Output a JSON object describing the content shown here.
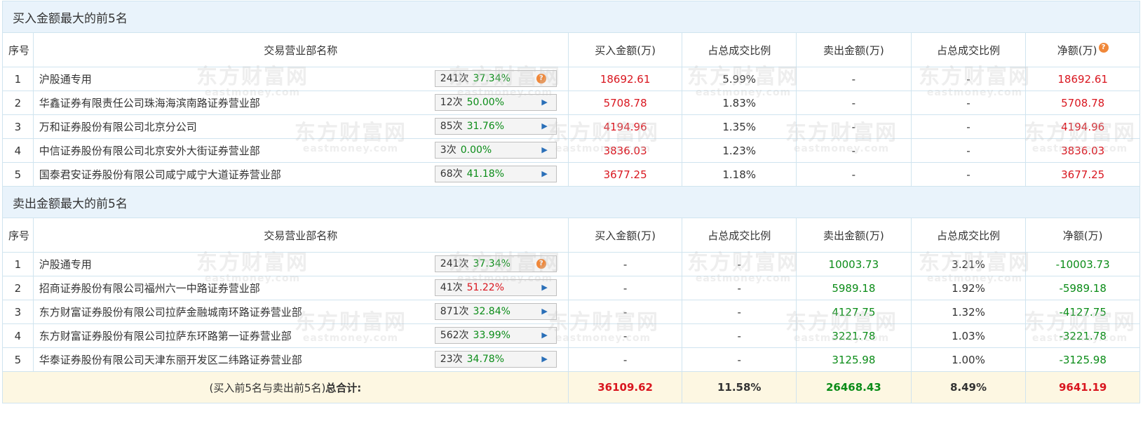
{
  "buy_section": {
    "title": "买入金额最大的前5名",
    "headers": {
      "idx": "序号",
      "name": "交易营业部名称",
      "buy": "买入金额(万)",
      "buy_ratio": "占总成交比例",
      "sell": "卖出金额(万)",
      "sell_ratio": "占总成交比例",
      "net": "净额(万)"
    },
    "rows": [
      {
        "idx": "1",
        "name": "沪股通专用",
        "count": "241次",
        "pct": "37.34%",
        "buy": "18692.61",
        "buy_ratio": "5.99%",
        "sell": "-",
        "sell_ratio": "-",
        "net": "18692.61"
      },
      {
        "idx": "2",
        "name": "华鑫证券有限责任公司珠海海滨南路证券营业部",
        "count": "12次",
        "pct": "50.00%",
        "buy": "5708.78",
        "buy_ratio": "1.83%",
        "sell": "-",
        "sell_ratio": "-",
        "net": "5708.78"
      },
      {
        "idx": "3",
        "name": "万和证券股份有限公司北京分公司",
        "count": "85次",
        "pct": "31.76%",
        "buy": "4194.96",
        "buy_ratio": "1.35%",
        "sell": "-",
        "sell_ratio": "-",
        "net": "4194.96"
      },
      {
        "idx": "4",
        "name": "中信证券股份有限公司北京安外大街证券营业部",
        "count": "3次",
        "pct": "0.00%",
        "buy": "3836.03",
        "buy_ratio": "1.23%",
        "sell": "-",
        "sell_ratio": "-",
        "net": "3836.03"
      },
      {
        "idx": "5",
        "name": "国泰君安证券股份有限公司咸宁咸宁大道证券营业部",
        "count": "68次",
        "pct": "41.18%",
        "buy": "3677.25",
        "buy_ratio": "1.18%",
        "sell": "-",
        "sell_ratio": "-",
        "net": "3677.25"
      }
    ]
  },
  "sell_section": {
    "title": "卖出金额最大的前5名",
    "headers": {
      "idx": "序号",
      "name": "交易营业部名称",
      "buy": "买入金额(万)",
      "buy_ratio": "占总成交比例",
      "sell": "卖出金额(万)",
      "sell_ratio": "占总成交比例",
      "net": "净额(万)"
    },
    "rows": [
      {
        "idx": "1",
        "name": "沪股通专用",
        "count": "241次",
        "pct": "37.34%",
        "buy": "-",
        "buy_ratio": "-",
        "sell": "10003.73",
        "sell_ratio": "3.21%",
        "net": "-10003.73"
      },
      {
        "idx": "2",
        "name": "招商证券股份有限公司福州六一中路证券营业部",
        "count": "41次",
        "pct": "51.22%",
        "buy": "-",
        "buy_ratio": "-",
        "sell": "5989.18",
        "sell_ratio": "1.92%",
        "net": "-5989.18"
      },
      {
        "idx": "3",
        "name": "东方财富证券股份有限公司拉萨金融城南环路证券营业部",
        "count": "871次",
        "pct": "32.84%",
        "buy": "-",
        "buy_ratio": "-",
        "sell": "4127.75",
        "sell_ratio": "1.32%",
        "net": "-4127.75"
      },
      {
        "idx": "4",
        "name": "东方财富证券股份有限公司拉萨东环路第一证券营业部",
        "count": "562次",
        "pct": "33.99%",
        "buy": "-",
        "buy_ratio": "-",
        "sell": "3221.78",
        "sell_ratio": "1.03%",
        "net": "-3221.78"
      },
      {
        "idx": "5",
        "name": "华泰证券股份有限公司天津东丽开发区二纬路证券营业部",
        "count": "23次",
        "pct": "34.78%",
        "buy": "-",
        "buy_ratio": "-",
        "sell": "3125.98",
        "sell_ratio": "1.00%",
        "net": "-3125.98"
      }
    ]
  },
  "total": {
    "label_prefix": "(买入前5名与卖出前5名)",
    "label_bold": "总合计:",
    "buy": "36109.62",
    "buy_ratio": "11.58%",
    "sell": "26468.43",
    "sell_ratio": "8.49%",
    "net": "9641.19"
  },
  "watermark": {
    "cn": "东方财富网",
    "en": "eastmoney.com"
  },
  "icons": {
    "help": "help-circle-icon",
    "expand": "play-right-icon"
  },
  "colors": {
    "buy_red": "#d9161f",
    "sell_green": "#0b8c18",
    "header_bg": "#e9f3fb",
    "total_bg": "#fdf7e2",
    "help_orange": "#f0883a"
  }
}
